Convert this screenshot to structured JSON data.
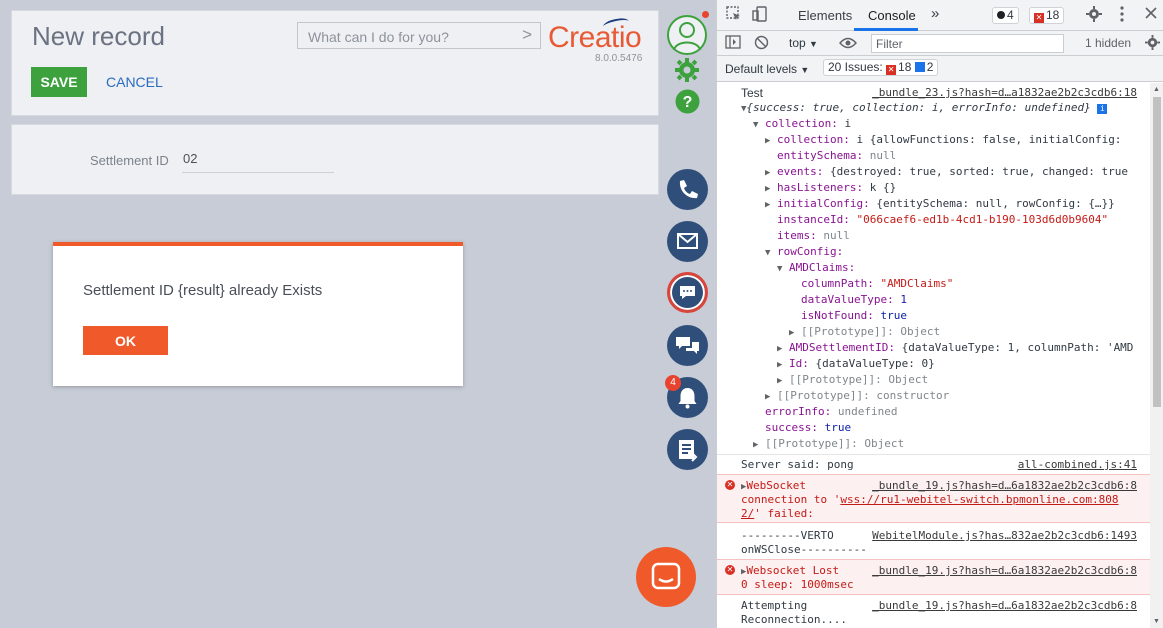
{
  "app": {
    "title": "New record",
    "save_label": "SAVE",
    "cancel_label": "CANCEL",
    "command_placeholder": "What can I do for you?",
    "command_arrow": ">",
    "logo": "Creatio",
    "version": "8.0.0.5476",
    "field_label": "Settlement ID",
    "field_value": "02",
    "notifications_count": "4"
  },
  "dialog": {
    "message": "Settlement ID {result} already Exists",
    "ok_label": "OK"
  },
  "devtools": {
    "tabs": [
      "Elements",
      "Console"
    ],
    "more": "»",
    "warnings_count": "4",
    "errors_count": "18",
    "context": "top",
    "filter_placeholder": "Filter",
    "hidden": "1 hidden",
    "levels": "Default levels",
    "issues_label": "20 Issues:",
    "issues_errors": "18",
    "issues_info": "2"
  },
  "console": {
    "test_label": "Test",
    "bundle23": "_bundle_23.js?hash=d…a1832ae2b2c3cdb6:18",
    "summary": "{success: true, collection: i, errorInfo: undefined}",
    "collection_key": "collection: ",
    "collection_val": "i",
    "collection_inner_key": "collection: ",
    "collection_inner_val": "i {allowFunctions: false, initialConfig:",
    "entity_key": "entitySchema: ",
    "entity_val": "null",
    "events_key": "events: ",
    "events_val": "{destroyed: true, sorted: true, changed: true",
    "haslisteners_key": "hasListeners: ",
    "haslisteners_val": "k {}",
    "initialconfig_key": "initialConfig: ",
    "initialconfig_val": "{entitySchema: null, rowConfig: {…}}",
    "instance_key": "instanceId: ",
    "instance_val": "\"066caef6-ed1b-4cd1-b190-103d6d0b9604\"",
    "items_key": "items: ",
    "items_val": "null",
    "rowconfig_key": "rowConfig:",
    "amdclaims_key": "AMDClaims:",
    "columnpath_key": "columnPath: ",
    "columnpath_val": "\"AMDClaims\"",
    "datavaluetype_key": "dataValueType: ",
    "datavaluetype_val": "1",
    "isnotfound_key": "isNotFound: ",
    "isnotfound_val": "true",
    "proto_object": "[[Prototype]]: Object",
    "amdsettle_key": "AMDSettlementID: ",
    "amdsettle_val": "{dataValueType: 1, columnPath: 'AMD",
    "id_key": "Id: ",
    "id_val": "{dataValueType: 0}",
    "proto_object2": "[[Prototype]]: Object",
    "proto_constructor": "[[Prototype]]: constructor",
    "errorinfo_key": "errorInfo: ",
    "errorinfo_val": "undefined",
    "success_key": "success: ",
    "success_val": "true",
    "proto_object3": "[[Prototype]]: Object",
    "pong": "Server said: pong",
    "pong_src": "all-combined.js:41",
    "ws_err_1": "WebSocket",
    "ws_err_src": "_bundle_19.js?hash=d…6a1832ae2b2c3cdb6:8",
    "ws_err_2": "connection to '",
    "ws_err_url": "wss://ru1-webitel-switch.bpmonline.com:808",
    "ws_err_3": "2/",
    "ws_err_4": "' failed:",
    "verto_1": "---------VERTO",
    "verto_src": "WebitelModule.js?has…832ae2b2c3cdb6:1493",
    "verto_2": "onWSClose----------",
    "lost_1": "Websocket Lost",
    "lost_src": "_bundle_19.js?hash=d…6a1832ae2b2c3cdb6:8",
    "lost_2": "0 sleep: 1000msec",
    "reconn_1": "Attempting",
    "reconn_src": "_bundle_19.js?hash=d…6a1832ae2b2c3cdb6:8",
    "reconn_2": "Reconnection...."
  }
}
